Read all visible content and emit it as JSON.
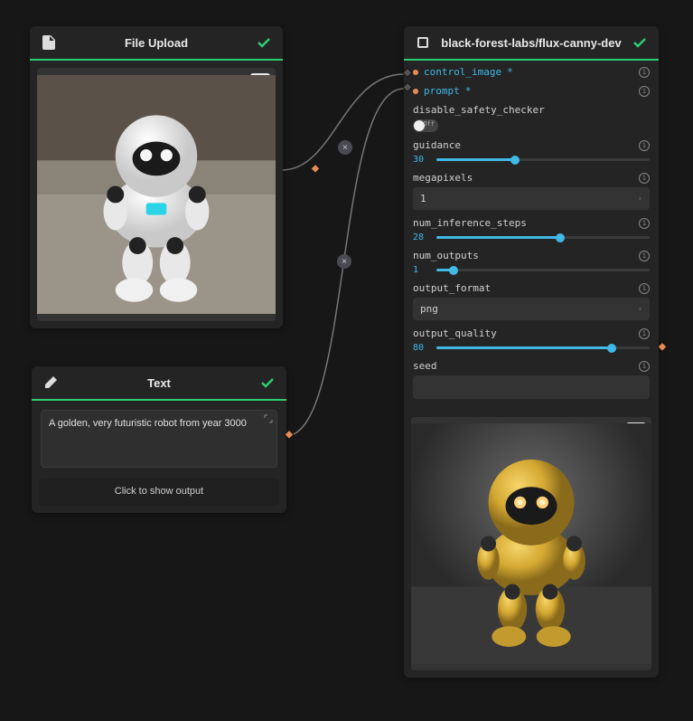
{
  "nodes": {
    "file_upload": {
      "title": "File Upload",
      "icon": "file-icon",
      "status": "success"
    },
    "text": {
      "title": "Text",
      "icon": "pencil-icon",
      "status": "success",
      "value": "A golden, very futuristic robot from year 3000",
      "show_output_label": "Click to show output"
    },
    "model": {
      "title": "black-forest-labs/flux-canny-dev",
      "icon": "model-icon",
      "status": "success",
      "params": {
        "control_image": {
          "label": "control_image",
          "required": true
        },
        "prompt": {
          "label": "prompt",
          "required": true
        },
        "disable_safety_checker": {
          "label": "disable_safety_checker",
          "value": false,
          "off_label": "Off"
        },
        "guidance": {
          "label": "guidance",
          "value": 30,
          "min": 0,
          "max": 100,
          "pct": 37
        },
        "megapixels": {
          "label": "megapixels",
          "value": "1"
        },
        "num_inference_steps": {
          "label": "num_inference_steps",
          "value": 28,
          "min": 0,
          "max": 50,
          "pct": 58
        },
        "num_outputs": {
          "label": "num_outputs",
          "value": 1,
          "min": 1,
          "max": 10,
          "pct": 8
        },
        "output_format": {
          "label": "output_format",
          "value": "png"
        },
        "output_quality": {
          "label": "output_quality",
          "value": 80,
          "min": 0,
          "max": 100,
          "pct": 82
        },
        "seed": {
          "label": "seed",
          "value": ""
        }
      }
    }
  },
  "icons": {
    "download": "download-icon",
    "info": "i",
    "expand": "expand-icon",
    "chevron": "›",
    "close": "×"
  }
}
